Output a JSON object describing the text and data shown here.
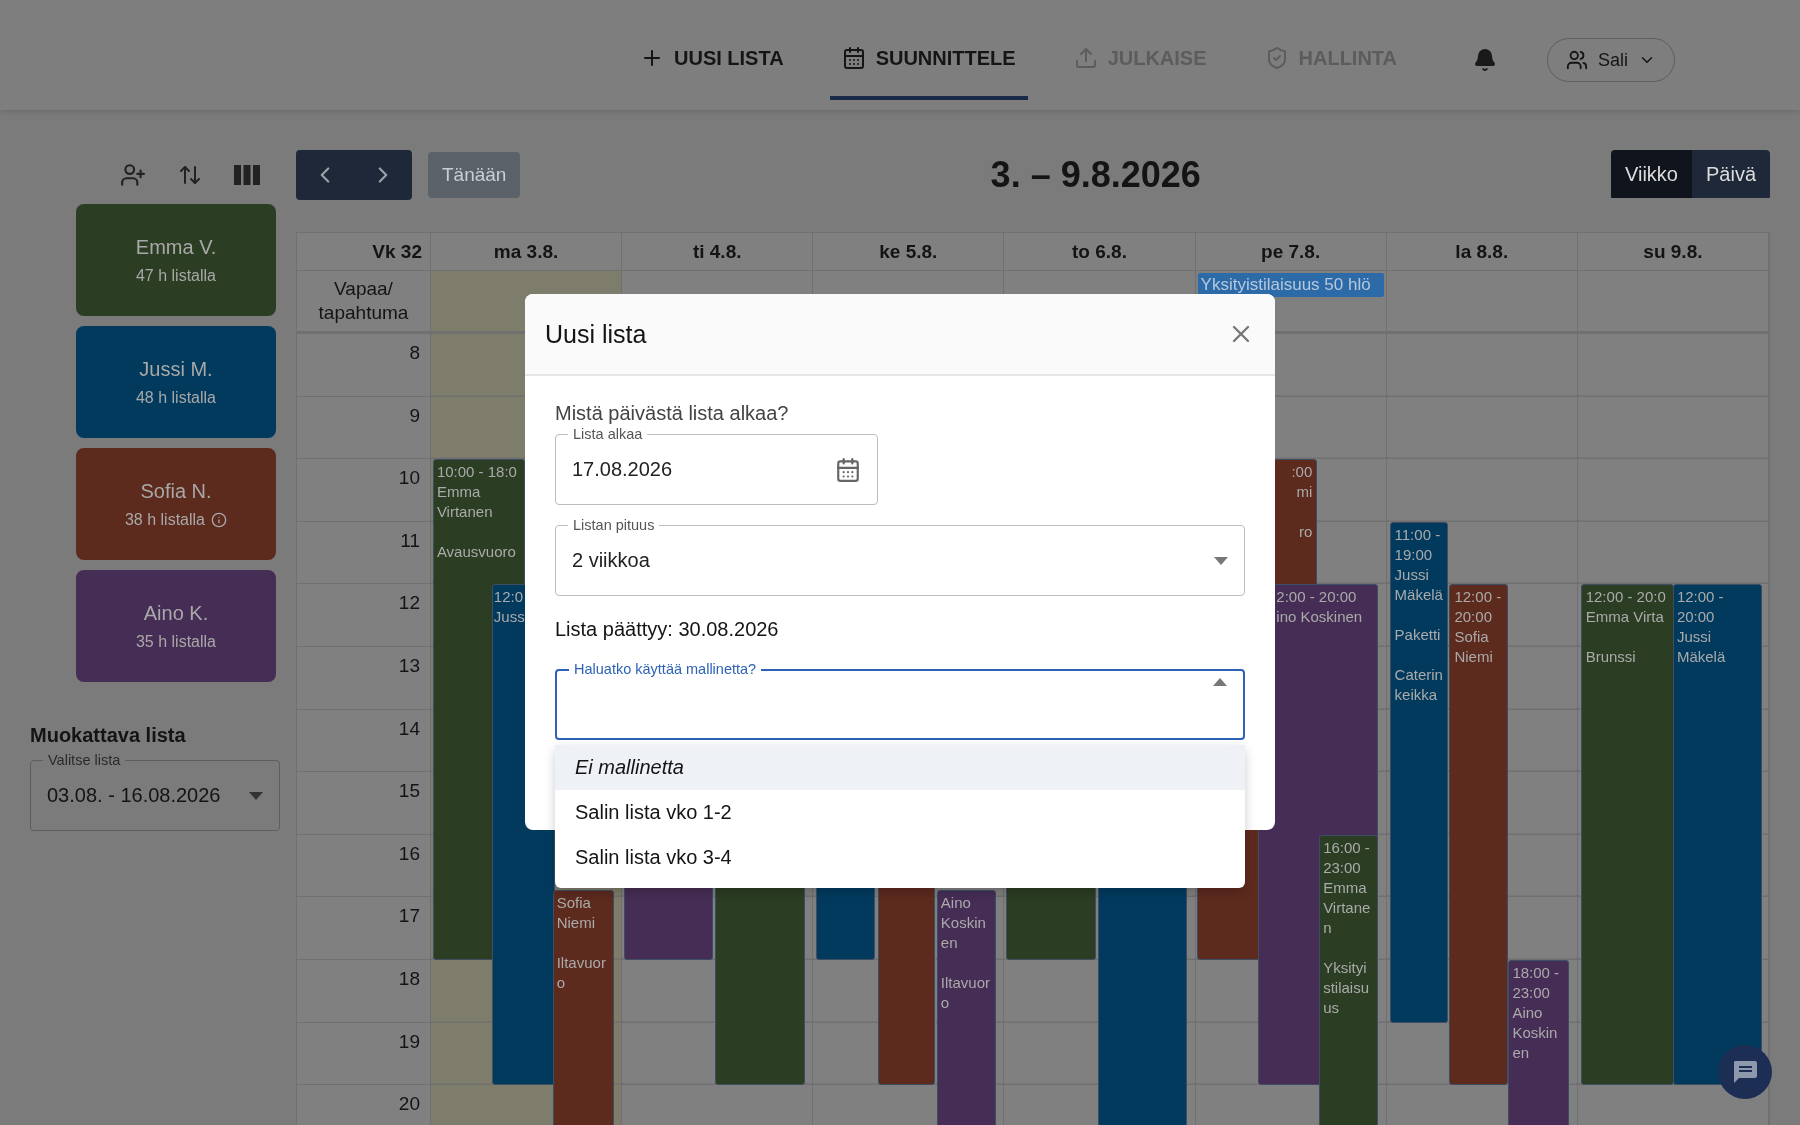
{
  "nav": {
    "items": [
      {
        "label": "UUSI LISTA",
        "selected": false,
        "disabled": false
      },
      {
        "label": "SUUNNITTELE",
        "selected": true,
        "disabled": false
      },
      {
        "label": "JULKAISE",
        "selected": false,
        "disabled": true
      },
      {
        "label": "HALLINTA",
        "selected": false,
        "disabled": true
      }
    ],
    "location": "Sali"
  },
  "toolbar": {
    "today": {
      "label": "Tänään",
      "disabled": true
    },
    "title": "3. – 9.8.2026",
    "views": [
      {
        "label": "Viikko",
        "selected": true
      },
      {
        "label": "Päivä",
        "selected": false
      }
    ]
  },
  "employees": [
    {
      "name": "Emma V.",
      "hours": "47 h listalla",
      "color": "#2b3d23",
      "info": false
    },
    {
      "name": "Jussi M.",
      "hours": "48 h listalla",
      "color": "#023a5e",
      "info": false
    },
    {
      "name": "Sofia N.",
      "hours": "38 h listalla",
      "color": "#5d2a1e",
      "info": true
    },
    {
      "name": "Aino K.",
      "hours": "35 h listalla",
      "color": "#462d55",
      "info": false
    }
  ],
  "list_picker": {
    "title": "Muokattava lista",
    "label": "Valitse lista",
    "value": "03.08. - 16.08.2026"
  },
  "calendar": {
    "week": "Vk 32",
    "allday_label": "Vapaa/ tapahtuma",
    "hours": [
      "8",
      "9",
      "10",
      "11",
      "12",
      "13",
      "14",
      "15",
      "16",
      "17",
      "18",
      "19",
      "20"
    ],
    "days": [
      {
        "label": "ma 3.8.",
        "today": true,
        "events": [
          {
            "time": "10:00 - 18:0",
            "name": "Emma Virtanen",
            "notes": [
              "Avausvuoro"
            ],
            "color": "#2b3d23"
          },
          {
            "time": "12:0",
            "name": "Juss",
            "color": "#023a5e"
          },
          {
            "name": "Sofia Niemi",
            "notes": [
              "Iltavuoro"
            ],
            "color": "#5d2a1e"
          }
        ]
      },
      {
        "label": "ti 4.8.",
        "today": false,
        "events": [
          {
            "color": "#462d55"
          },
          {
            "color": "#2b3d23"
          }
        ]
      },
      {
        "label": "ke 5.8.",
        "today": false,
        "events": [
          {
            "color": "#023a5e"
          },
          {
            "color": "#5d2a1e"
          },
          {
            "name": "Aino Koskinen",
            "notes": [
              "Iltavuoro"
            ],
            "color": "#462d55"
          }
        ]
      },
      {
        "label": "to 6.8.",
        "today": false,
        "events": [
          {
            "color": "#2b3d23"
          },
          {
            "color": "#023a5e"
          }
        ]
      },
      {
        "label": "pe 7.8.",
        "today": false,
        "allday": [
          "Yksityistilaisuus 50 hlö"
        ],
        "events": [
          {
            "time": ":00",
            "name": "mi",
            "notes": [
              "ro"
            ],
            "color": "#5d2a1e"
          },
          {
            "time": "2:00 - 20:00",
            "name": "ino Koskinen",
            "color": "#462d55"
          },
          {
            "time": "16:00 - 23:00",
            "name": "Emma Virtanen",
            "notes": [
              "Yksityistilaisuus"
            ],
            "color": "#2b3d23"
          }
        ]
      },
      {
        "label": "la 8.8.",
        "today": false,
        "events": [
          {
            "time": "11:00 - 19:00",
            "name": "Jussi Mäkelä",
            "notes": [
              "Paketti",
              "Caterin keikka"
            ],
            "color": "#023a5e"
          },
          {
            "time": "12:00 - 20:00",
            "name": "Sofia Niemi",
            "color": "#5d2a1e"
          },
          {
            "time": "18:00 - 23:00",
            "name": "Aino Koskinen",
            "color": "#462d55"
          }
        ]
      },
      {
        "label": "su 9.8.",
        "today": false,
        "events": [
          {
            "time": "12:00 - 20:0",
            "name": "Emma Virta",
            "notes": [
              "Brunssi"
            ],
            "color": "#2b3d23"
          },
          {
            "time": "12:00 - 20:00",
            "name": "Jussi Mäkelä",
            "color": "#023a5e"
          }
        ]
      }
    ]
  },
  "dialog": {
    "title": "Uusi lista",
    "question": "Mistä päivästä lista alkaa?",
    "start_field": {
      "label": "Lista alkaa",
      "value": "17.08.2026"
    },
    "length_field": {
      "label": "Listan pituus",
      "value": "2 viikkoa"
    },
    "end_text": "Lista päättyy: 30.08.2026",
    "template_field": {
      "label": "Haluatko käyttää mallinetta?",
      "expanded": true,
      "options": [
        {
          "label": "Ei mallinetta",
          "selected": true
        },
        {
          "label": "Salin lista vko 1-2",
          "selected": false
        },
        {
          "label": "Salin lista vko 3-4",
          "selected": false
        }
      ]
    }
  }
}
